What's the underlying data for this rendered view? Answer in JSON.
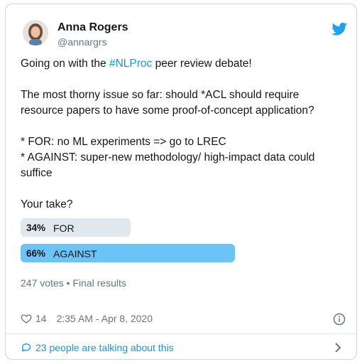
{
  "tweet": {
    "author": {
      "name": "Anna Rogers",
      "handle": "@annargrs"
    },
    "text": {
      "line1_before": "Going on with the ",
      "hashtag": "#NLProc",
      "line1_after": " peer review debate!",
      "para2": "The most thorny issue so far: should *ACL should require resource papers to have some proof-of-concept application?",
      "para3": "* FOR: no ML experiments => go to LREC\n* AGAINST: super-new methodology/ high-impact data could suffice",
      "para4": "Your take?"
    },
    "poll": {
      "options": [
        {
          "percent": "34%",
          "label": "FOR",
          "fraction": 0.34
        },
        {
          "percent": "66%",
          "label": "AGAINST",
          "fraction": 0.66
        }
      ],
      "summary": "247 votes • Final results"
    },
    "likes": "14",
    "timestamp": "2:35 AM - Apr 8, 2020",
    "conversation_link": "23 people are talking about this"
  },
  "colors": {
    "link": "#1b95e0",
    "twitter_blue": "#1da1f2",
    "poll_winner": "#6cc3f5",
    "poll_other": "#e1e8ed"
  },
  "icons": [
    "twitter-bird-icon",
    "heart-icon",
    "info-icon",
    "comment-bubble-icon",
    "chevron-right-icon"
  ]
}
